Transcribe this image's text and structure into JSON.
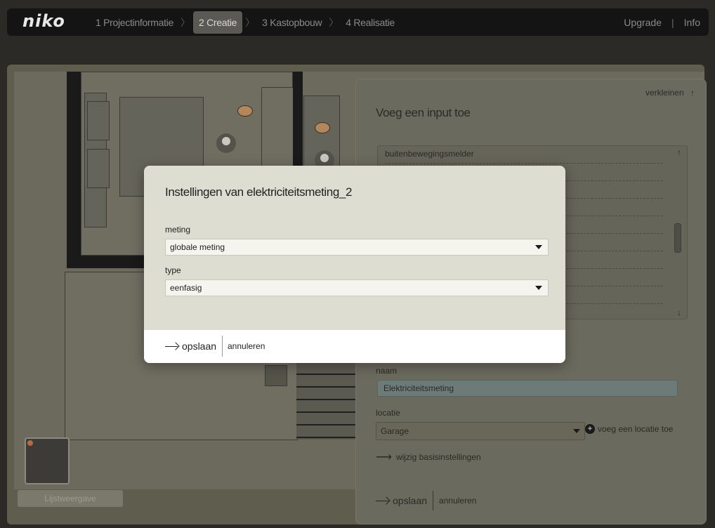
{
  "nav": {
    "logo": "niko",
    "steps": [
      {
        "label": "1 Projectinformatie",
        "active": false
      },
      {
        "label": "2 Creatie",
        "active": true
      },
      {
        "label": "3 Kastopbouw",
        "active": false
      },
      {
        "label": "4 Realisatie",
        "active": false
      }
    ],
    "upgrade": "Upgrade",
    "separator": "|",
    "info": "Info"
  },
  "canvas": {
    "list_view_button": "Lijstweergave"
  },
  "panel": {
    "collapse_label": "verkleinen",
    "collapse_icon": "↑",
    "title": "Voeg een input toe",
    "input_list": {
      "items": [
        "buitenbewegingsmelder",
        "",
        "",
        "",
        "",
        "",
        "",
        "",
        "",
        ""
      ],
      "scroll_up": "↑",
      "scroll_down": "↓"
    },
    "name_label": "naam",
    "name_value": "Elektriciteitsmeting",
    "location_label": "locatie",
    "location_value": "Garage",
    "add_location": "voeg een locatie toe",
    "change_settings": "wijzig basisinstellingen",
    "save": "opslaan",
    "cancel": "annuleren"
  },
  "modal": {
    "title": "Instellingen van elektriciteitsmeting_2",
    "meting_label": "meting",
    "meting_value": "globale meting",
    "type_label": "type",
    "type_value": "eenfasig",
    "save": "opslaan",
    "cancel": "annuleren"
  }
}
